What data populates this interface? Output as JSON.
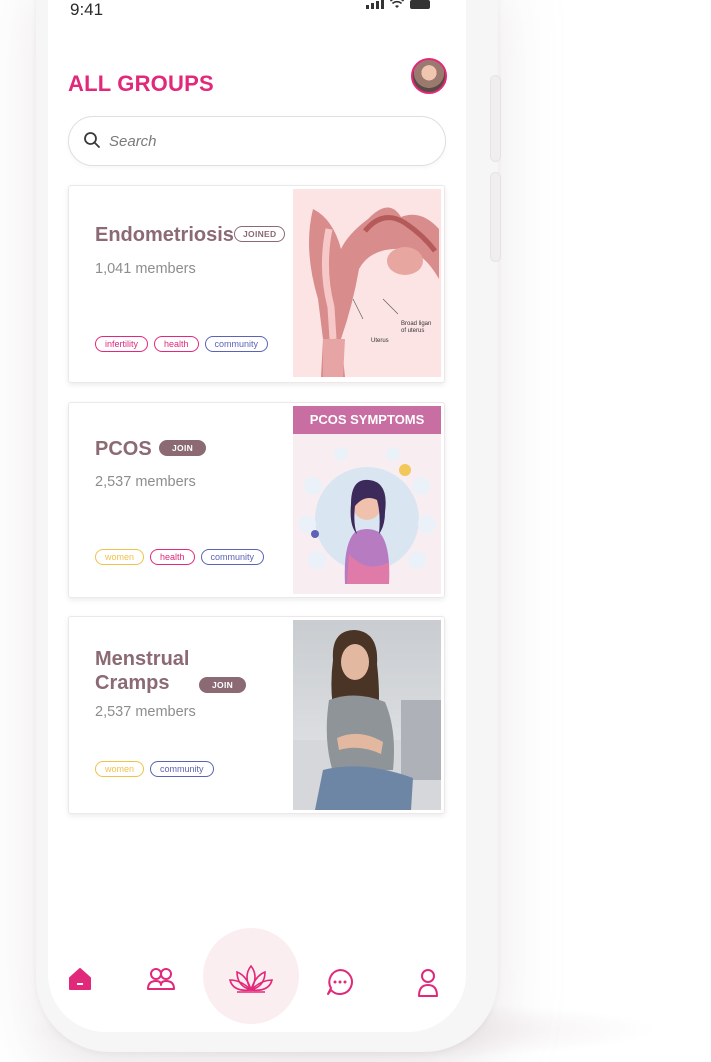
{
  "status": {
    "time": "9:41"
  },
  "header": {
    "title": "ALL GROUPS"
  },
  "search": {
    "placeholder": "Search"
  },
  "groups": [
    {
      "name": "Endometriosis",
      "badge": "JOINED",
      "members": "1,041 members",
      "tags": [
        "infertility",
        "health",
        "community"
      ],
      "image_labels": [
        "Broad ligan",
        "of uterus",
        "Uterus"
      ]
    },
    {
      "name": "PCOS",
      "badge": "JOIN",
      "members": "2,537 members",
      "tags": [
        "women",
        "health",
        "community"
      ],
      "image_title": "PCOS SYMPTOMS"
    },
    {
      "name_line1": "Menstrual",
      "name_line2": "Cramps",
      "badge": "JOIN",
      "members": "2,537 members",
      "tags": [
        "women",
        "community"
      ]
    }
  ],
  "nav": [
    "home-icon",
    "groups-icon",
    "lotus-icon",
    "chat-icon",
    "profile-icon"
  ],
  "colors": {
    "accent": "#e2287a",
    "mauve": "#8b6a73",
    "blue": "#5a63b7",
    "yellow": "#f0c24a"
  }
}
